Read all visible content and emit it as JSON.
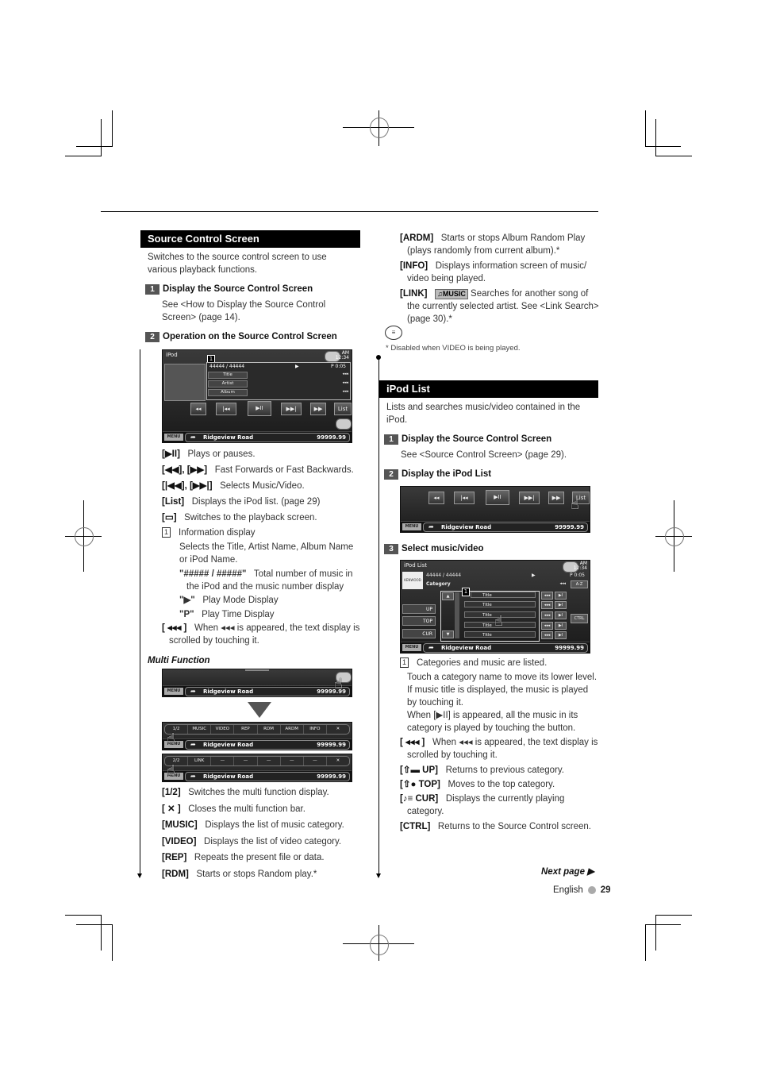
{
  "left": {
    "section_title": "Source Control Screen",
    "intro": "Switches to the source control screen to use various playback functions.",
    "step1": {
      "num": "1",
      "title": "Display the Source Control Screen",
      "body": "See <How to Display the Source Control Screen> (page 14)."
    },
    "step2": {
      "num": "2",
      "title": "Operation on the Source Control Screen"
    },
    "screen1": {
      "title": "iPod",
      "clock_ampm": "AM",
      "clock_time": "12:34",
      "callout": "1",
      "track_count": "44444 / 44444",
      "play_mode": "▶",
      "play_time": "P  0:05",
      "labels": [
        "Title",
        "Artist",
        "Album"
      ],
      "scroll_glyph": "◂◂◂",
      "controls": [
        "◂◂",
        "|◂◂",
        "▶II",
        "▶▶|",
        "▶▶",
        "List"
      ],
      "menu": "MENU",
      "road": "Ridgeview Road",
      "distance": "99999.99"
    },
    "items": [
      {
        "key": "[▶II]",
        "text": "Plays or pauses."
      },
      {
        "key": "[◀◀], [▶▶]",
        "text": "Fast Forwards or Fast Backwards."
      },
      {
        "key": "[|◀◀], [▶▶|]",
        "text": "Selects Music/Video."
      },
      {
        "key": "[List]",
        "text": "Displays the iPod list. (page 29)"
      },
      {
        "key": "[▭]",
        "text": "Switches to the playback screen."
      }
    ],
    "info_display": {
      "num": "1",
      "title": "Information display",
      "desc": "Selects the Title, Artist Name, Album Name or iPod Name.",
      "sub": [
        {
          "key": "\"##### / #####\"",
          "text": "Total number of music in the iPod and the music number display"
        },
        {
          "key": "\"▶\"",
          "text": "Play Mode Display"
        },
        {
          "key": "\"P\"",
          "text": "Play Time Display"
        }
      ]
    },
    "scroll_item": {
      "key": "[ ◂◂◂ ]",
      "text": "When ◂◂◂ is appeared, the text display is scrolled by touching it."
    },
    "multi_function_title": "Multi Function",
    "mf_bar1": [
      "1/2",
      "MUSIC",
      "VIDEO",
      "REP",
      "RDM",
      "ARDM",
      "INFO",
      "✕"
    ],
    "mf_bar2": [
      "2/2",
      "LINK",
      "—",
      "—",
      "—",
      "—",
      "—",
      "✕"
    ],
    "mf_items": [
      {
        "key": "[1/2]",
        "text": "Switches the multi function display."
      },
      {
        "key": "[ ✕ ]",
        "text": "Closes the multi function bar."
      },
      {
        "key": "[MUSIC]",
        "text": "Displays the list of music category."
      },
      {
        "key": "[VIDEO]",
        "text": "Displays the list of video category."
      },
      {
        "key": "[REP]",
        "text": "Repeats the present file or data."
      },
      {
        "key": "[RDM]",
        "text": "Starts or stops Random play.*"
      }
    ]
  },
  "right": {
    "mf_items": [
      {
        "key": "[ARDM]",
        "text": "Starts or stops Album Random Play (plays randomly from current album).*"
      },
      {
        "key": "[INFO]",
        "text": "Displays information screen of music/ video being played."
      },
      {
        "key": "[LINK]",
        "badge": "♫MUSIC",
        "text": "Searches for another song of the currently selected artist. See <Link Search> (page 30).*"
      }
    ],
    "footnote": "* Disabled when VIDEO is being played.",
    "section_title": "iPod List",
    "intro": "Lists and searches music/video contained in the iPod.",
    "step1": {
      "num": "1",
      "title": "Display the Source Control Screen",
      "body": "See <Source Control Screen> (page 29)."
    },
    "step2": {
      "num": "2",
      "title": "Display the iPod List"
    },
    "step3": {
      "num": "3",
      "title": "Select music/video"
    },
    "list_screen": {
      "title": "iPod List",
      "clock_ampm": "AM",
      "clock_time": "12:34",
      "logo": "KENWOOD",
      "track_count": "44444 / 44444",
      "play_mode": "▶",
      "play_time": "P  0:05",
      "category": "Category",
      "az": "A-Z",
      "callout": "1",
      "rows": [
        "Title",
        "Title",
        "Title",
        "Title",
        "Title"
      ],
      "side": [
        "UP",
        "TOP",
        "CUR"
      ],
      "ctrl": "CTRL",
      "menu": "MENU",
      "road": "Ridgeview Road",
      "distance": "99999.99"
    },
    "list_desc": {
      "num": "1",
      "title": "Categories and music are listed.",
      "body": "Touch a category name to move its lower level. If music title is displayed, the music is played by touching it.",
      "body2": "When [▶II] is appeared, all the music in its category is played by touching the button."
    },
    "items": [
      {
        "key": "[ ◂◂◂ ]",
        "text": "When ◂◂◂ is appeared, the text display is scrolled by touching it."
      },
      {
        "key": "[⇧▬ UP]",
        "text": "Returns to previous category."
      },
      {
        "key": "[⇧● TOP]",
        "text": "Moves to the top category."
      },
      {
        "key": "[♪≡ CUR]",
        "text": "Displays the currently playing category."
      },
      {
        "key": "[CTRL]",
        "text": "Returns to the Source Control screen."
      }
    ]
  },
  "footer": {
    "next_page": "Next page ▶",
    "language": "English",
    "page_number": "29"
  }
}
